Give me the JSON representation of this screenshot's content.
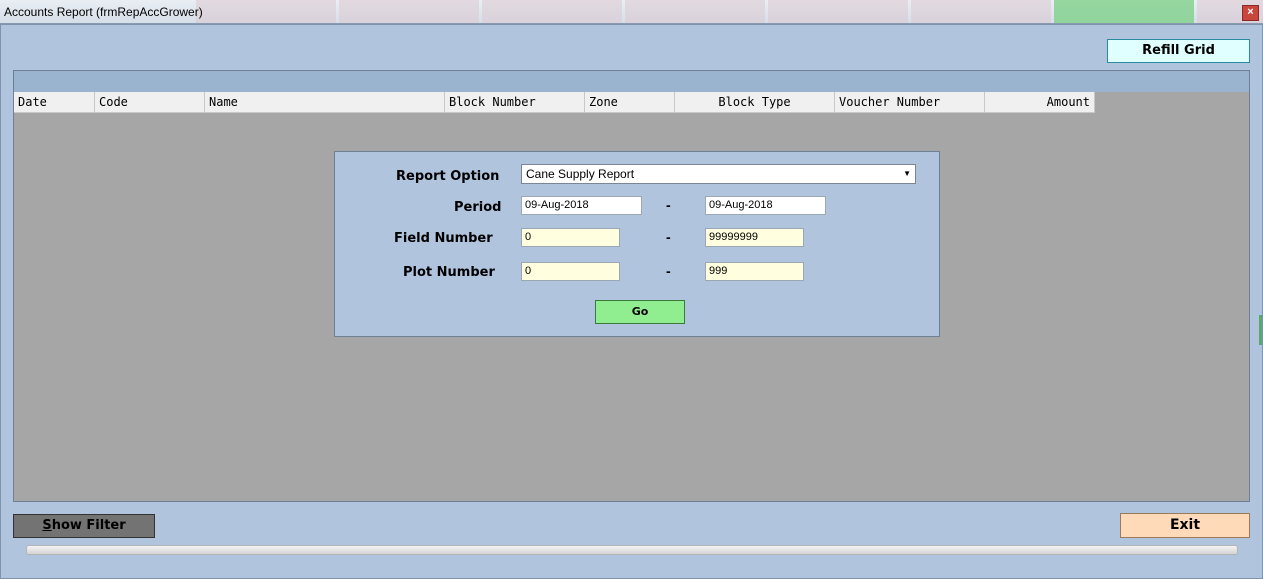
{
  "window": {
    "title": "Accounts Report (frmRepAccGrower)",
    "close_label": "×"
  },
  "toolbar": {
    "refill_label": "Refill Grid",
    "show_filter_label_first": "S",
    "show_filter_label_rest": "how Filter",
    "exit_label": "Exit"
  },
  "grid": {
    "columns": [
      "Date",
      "Code",
      "Name",
      "Block Number",
      "Zone",
      "Block Type",
      "Voucher Number",
      "Amount"
    ]
  },
  "filter": {
    "report_option_label": "Report Option",
    "report_option_value": "Cane Supply Report",
    "period_label": "Period",
    "period_from": "09-Aug-2018",
    "period_to": "09-Aug-2018",
    "field_number_label": "Field Number",
    "field_from": "0",
    "field_to": "99999999",
    "plot_number_label": "Plot Number",
    "plot_from": "0",
    "plot_to": "999",
    "range_separator": "-",
    "go_label": "Go"
  },
  "colors": {
    "background": "#b0c4de",
    "grid_fill": "#a6a6a6",
    "refill_button": "#e0ffff",
    "go_button": "#90ee90",
    "exit_button": "#ffdab9",
    "show_filter_button": "#737373"
  }
}
